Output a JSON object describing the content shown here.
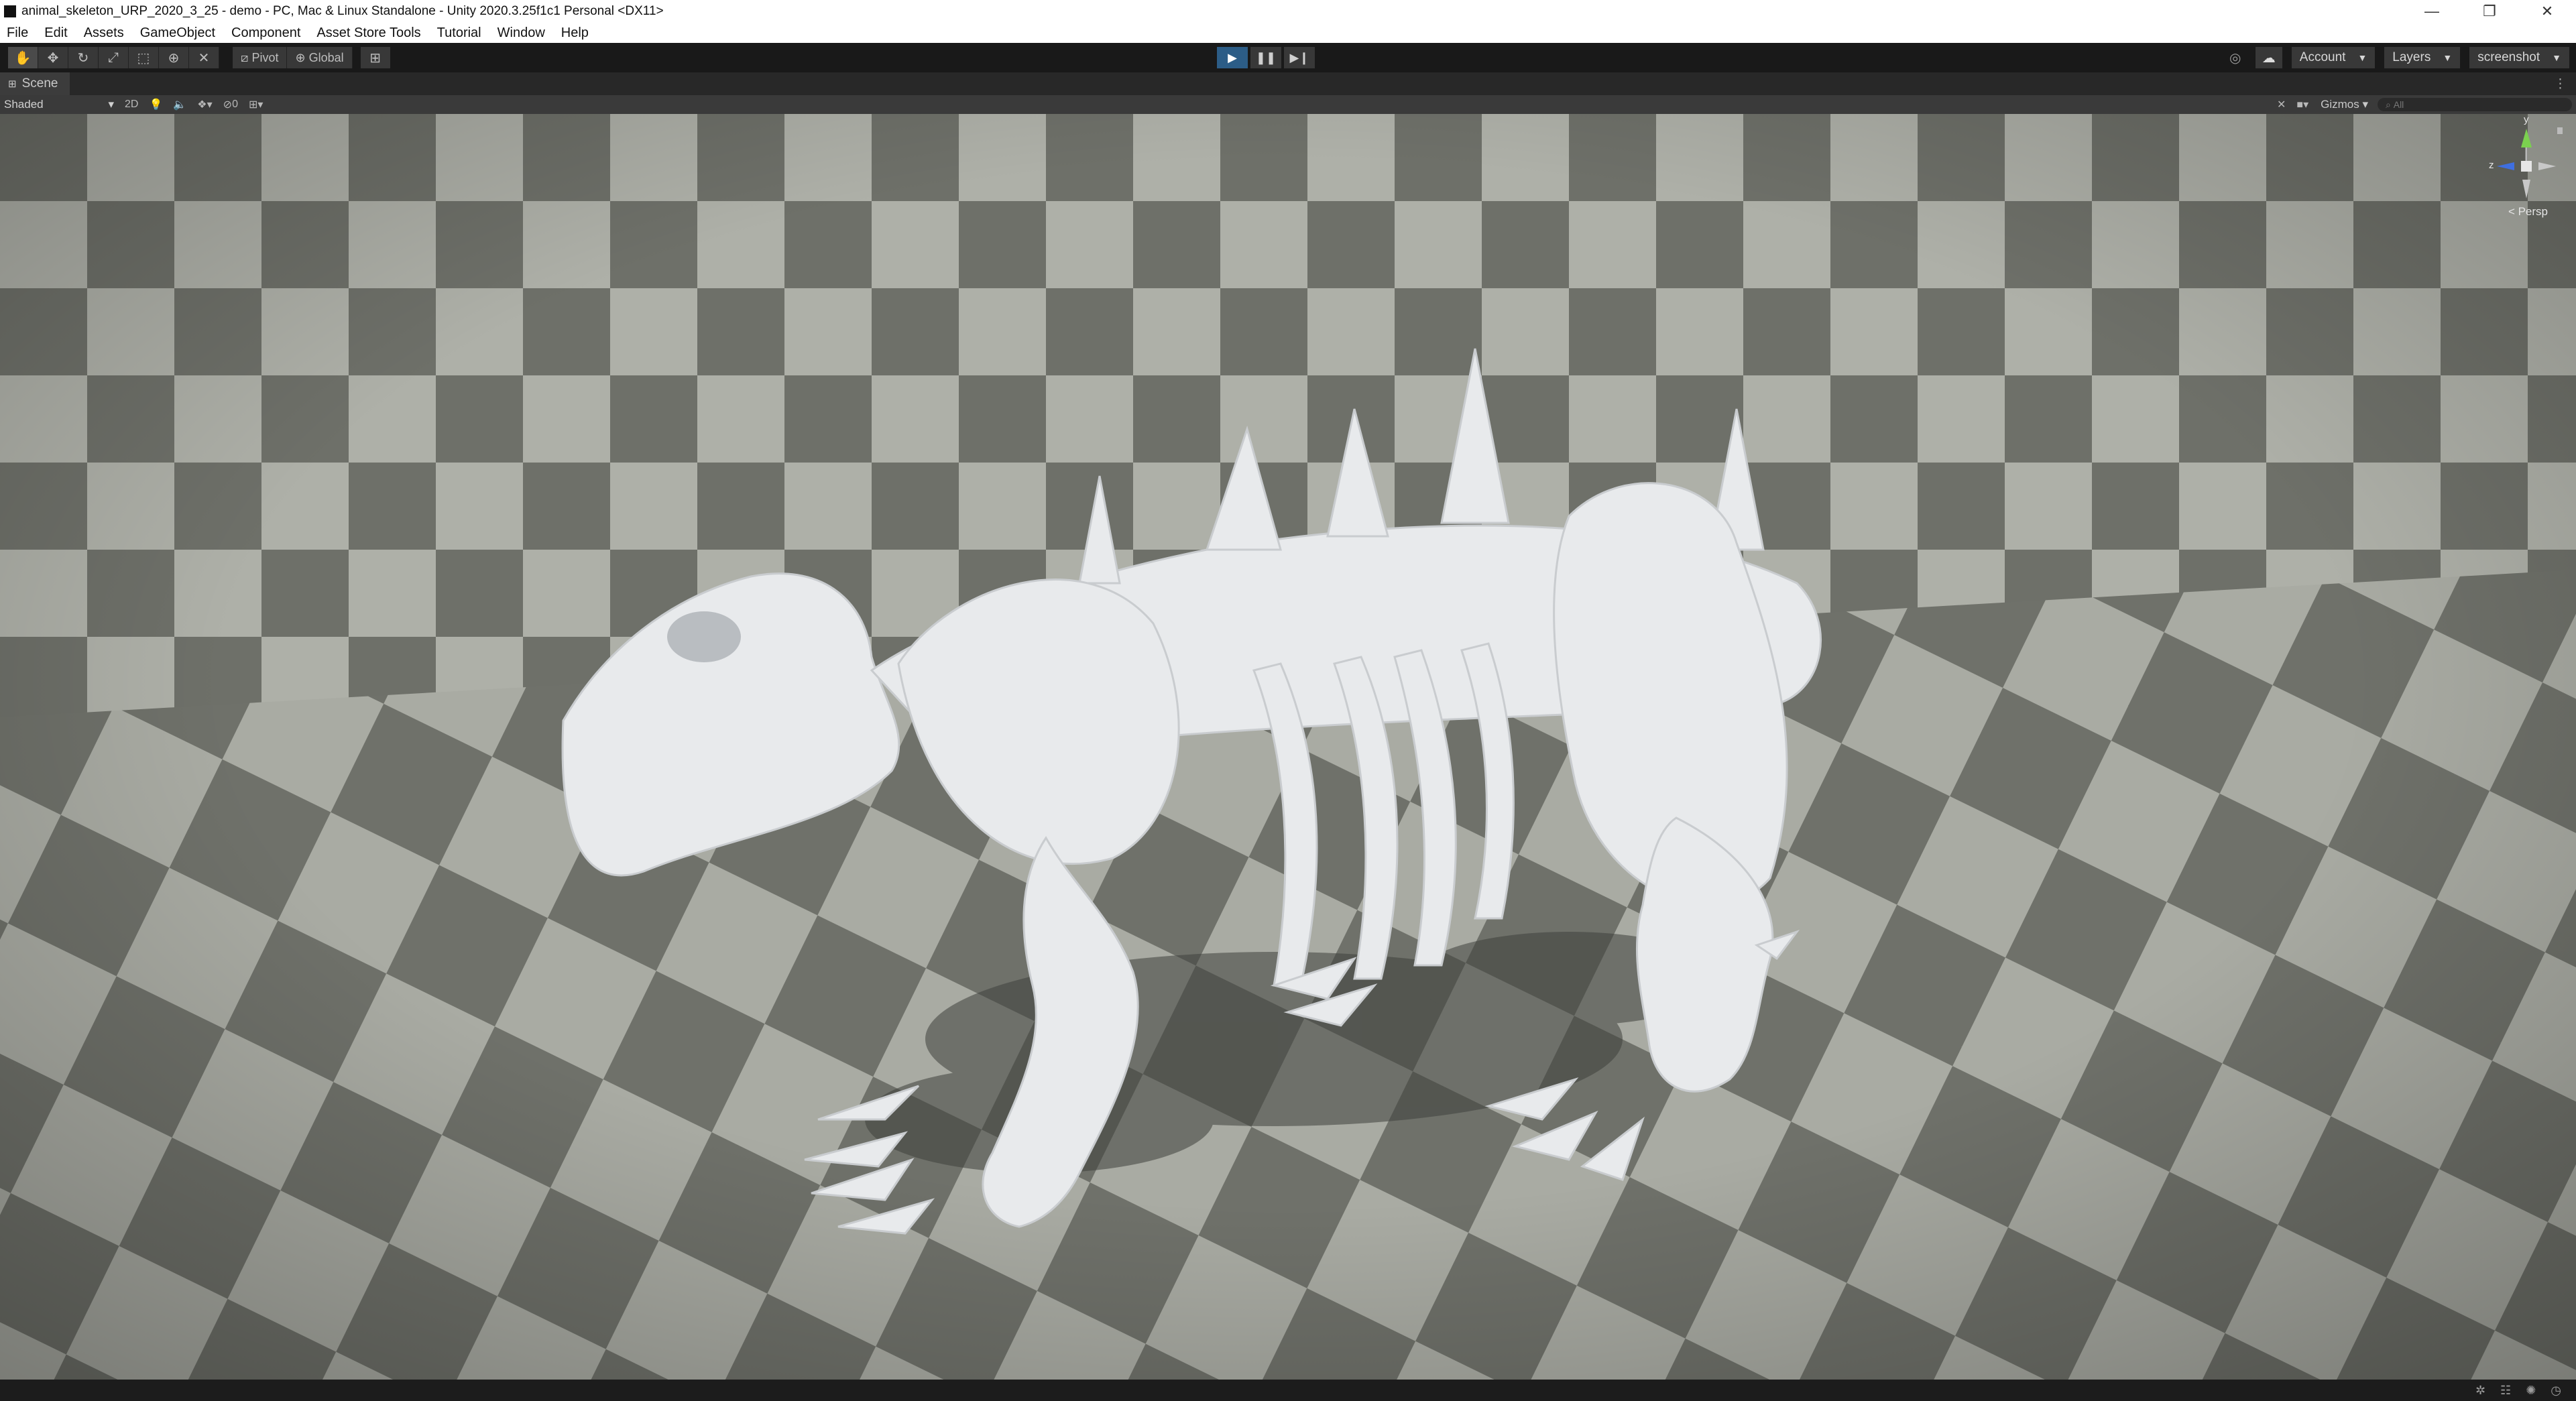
{
  "window": {
    "title": "animal_skeleton_URP_2020_3_25 - demo - PC, Mac & Linux Standalone - Unity 2020.3.25f1c1 Personal <DX11>",
    "controls": [
      "—",
      "❐",
      "✕"
    ]
  },
  "menu": [
    "File",
    "Edit",
    "Assets",
    "GameObject",
    "Component",
    "Asset Store Tools",
    "Tutorial",
    "Window",
    "Help"
  ],
  "toolbar": {
    "pivot_label": "Pivot",
    "global_label": "Global",
    "account_label": "Account",
    "layers_label": "Layers",
    "layout_label": "screenshot"
  },
  "scene_tab": {
    "label": "Scene"
  },
  "scene_bar": {
    "shading_mode": "Shaded",
    "mode_2d": "2D",
    "hidden_count": "0",
    "gizmos_label": "Gizmos",
    "search_placeholder": "All"
  },
  "viewport": {
    "axis_y": "y",
    "axis_z": "z",
    "projection_label": "< Persp"
  },
  "colors": {
    "floor_light": "#aeb0a8",
    "floor_dark": "#6e7069",
    "bone": "#e8eaec",
    "play_active": "#2c5d87"
  }
}
